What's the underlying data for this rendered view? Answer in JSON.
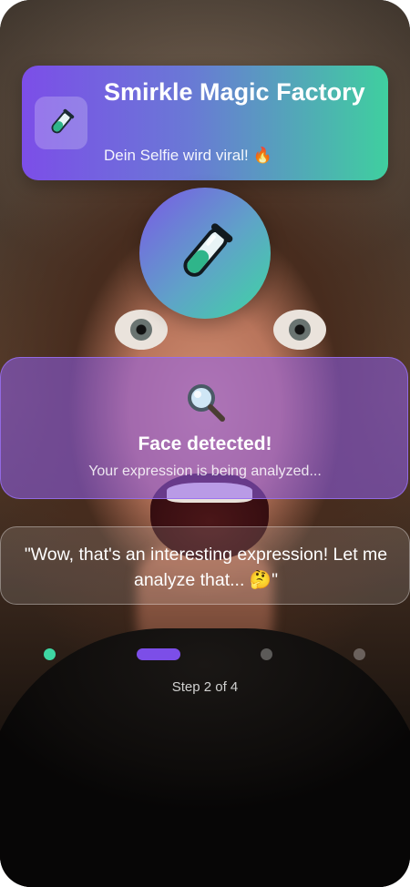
{
  "header": {
    "title": "Smirkle Magic Factory",
    "subtitle": "Dein Selfie wird viral! 🔥",
    "icon": "test-tube-icon"
  },
  "center_badge": {
    "icon": "test-tube-icon"
  },
  "analysis": {
    "icon": "magnifying-glass-icon",
    "title": "Face detected!",
    "subtitle": "Your expression is being analyzed..."
  },
  "quote": {
    "text": "\"Wow, that's an interesting expression! Let me analyze that... 🤔\""
  },
  "progress": {
    "current_step": 2,
    "total_steps": 4,
    "label": "Step 2 of 4"
  },
  "colors": {
    "accent_purple": "#7c4ee8",
    "accent_green": "#3ed6a2"
  }
}
